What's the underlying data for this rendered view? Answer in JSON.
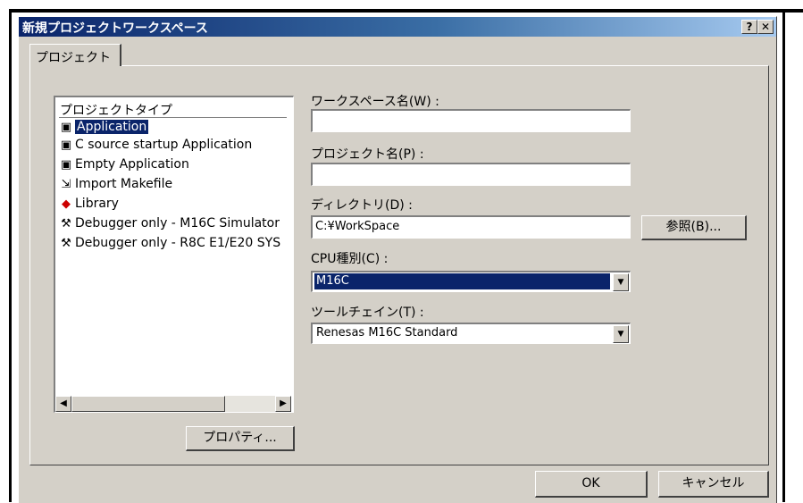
{
  "window": {
    "title": "新規プロジェクトワークスペース",
    "help_button": "?",
    "close_button": "✕"
  },
  "tabs": [
    {
      "label": "プロジェクト",
      "active": true
    }
  ],
  "project_types": {
    "header": "プロジェクトタイプ",
    "items": [
      {
        "label": "Application",
        "icon": "application-icon",
        "selected": true
      },
      {
        "label": "C source startup Application",
        "icon": "application-icon",
        "selected": false
      },
      {
        "label": "Empty Application",
        "icon": "application-icon",
        "selected": false
      },
      {
        "label": "Import Makefile",
        "icon": "import-icon",
        "selected": false
      },
      {
        "label": "Library",
        "icon": "library-icon",
        "selected": false
      },
      {
        "label": "Debugger only - M16C Simulator",
        "icon": "debugger-icon",
        "selected": false
      },
      {
        "label": "Debugger only - R8C E1/E20 SYS",
        "icon": "debugger-icon",
        "selected": false
      }
    ]
  },
  "properties_button": "プロパティ...",
  "form": {
    "workspace_name_label": "ワークスペース名(W) :",
    "workspace_name_value": "",
    "project_name_label": "プロジェクト名(P) :",
    "project_name_value": "",
    "directory_label": "ディレクトリ(D) :",
    "directory_value": "C:¥WorkSpace",
    "browse_button": "参照(B)...",
    "cpu_label": "CPU種別(C) :",
    "cpu_value": "M16C",
    "toolchain_label": "ツールチェイン(T) :",
    "toolchain_value": "Renesas M16C Standard"
  },
  "footer": {
    "ok_button": "OK",
    "cancel_button": "キャンセル"
  },
  "colors": {
    "face": "#d4d0c8",
    "selection": "#0a246a",
    "title_gradient_start": "#0a246a",
    "title_gradient_end": "#a6caf0"
  }
}
